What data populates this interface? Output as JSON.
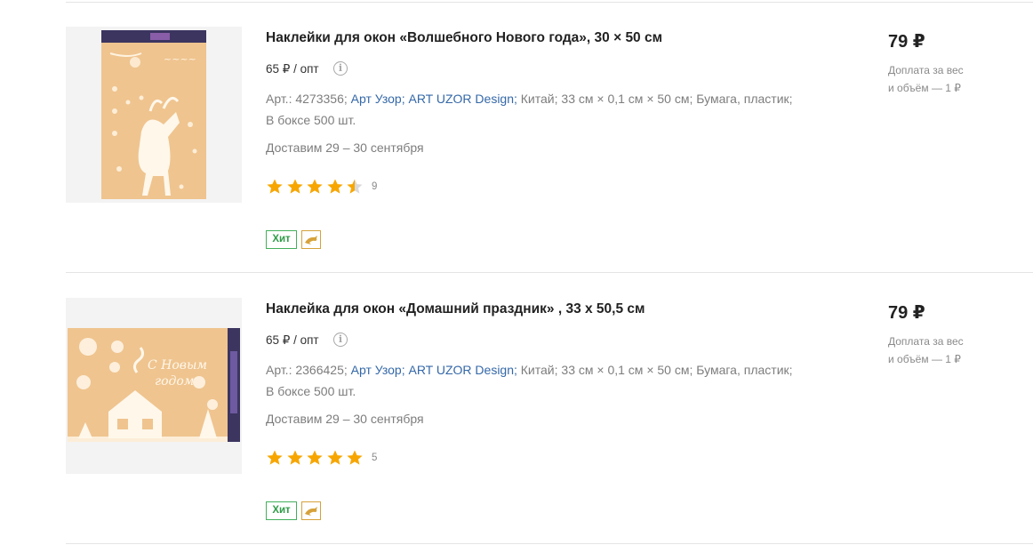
{
  "products": [
    {
      "title": "Наклейки для окон «Волшебного Нового года», 30 × 50 см",
      "unit_price": "65 ₽ / опт",
      "info_icon": "info-icon",
      "article_label": "Арт.: 4273356;",
      "brand_link": "Арт Узор;",
      "manufacturer_link": "ART UZOR Design;",
      "country": "Китай;",
      "dimensions": "33 см × 0,1 см × 50 см;",
      "material": "Бумага, пластик;",
      "box_qty": "В боксе 500 шт.",
      "delivery": "Доставим 29 – 30 сентября",
      "rating": 4.5,
      "review_count": "9",
      "badge": "Хит",
      "badge_icon": "dolphin-icon",
      "price": "79 ₽",
      "surcharge_line1": "Доплата за вес",
      "surcharge_line2": "и объём — 1 ₽"
    },
    {
      "title": "Наклейка для окон «Домашний праздник» , 33 х 50,5 см",
      "unit_price": "65 ₽ / опт",
      "info_icon": "info-icon",
      "article_label": "Арт.: 2366425;",
      "brand_link": "Арт Узор;",
      "manufacturer_link": "ART UZOR Design;",
      "country": "Китай;",
      "dimensions": "33 см × 0,1 см × 50 см;",
      "material": "Бумага, пластик;",
      "box_qty": "В боксе 500 шт.",
      "delivery": "Доставим 29 – 30 сентября",
      "rating": 5,
      "review_count": "5",
      "badge": "Хит",
      "badge_icon": "dolphin-icon",
      "price": "79 ₽",
      "surcharge_line1": "Доплата за вес",
      "surcharge_line2": "и объём — 1 ₽"
    }
  ],
  "colors": {
    "star": "#f7a600",
    "link": "#3468a8",
    "badge_green": "#43b05c",
    "badge_gold": "#d6a23a"
  }
}
